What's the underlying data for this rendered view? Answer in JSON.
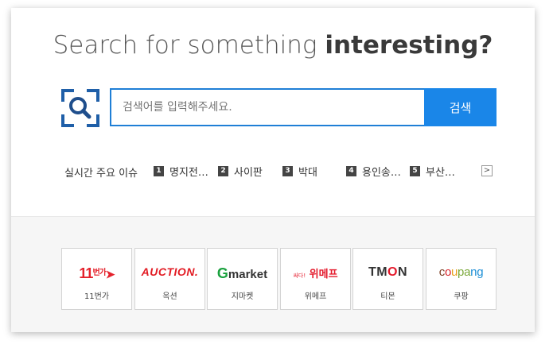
{
  "headline": {
    "prefix": "Search for something ",
    "emphasis": "interesting?"
  },
  "search": {
    "placeholder": "검색어를 입력해주세요.",
    "button_label": "검색"
  },
  "trending": {
    "label": "실시간 주요 이슈",
    "items": [
      {
        "rank": "1",
        "text": "명지전…"
      },
      {
        "rank": "2",
        "text": "사이판"
      },
      {
        "rank": "3",
        "text": "박대"
      },
      {
        "rank": "4",
        "text": "용인송…"
      },
      {
        "rank": "5",
        "text": "부산…"
      }
    ],
    "next_label": ">"
  },
  "shops": [
    {
      "logo_text": "11",
      "logo_sub": "번가",
      "name": "11번가",
      "color": "#e4222c"
    },
    {
      "logo_text": "AUCTION.",
      "name": "옥션",
      "color": "#e21b23"
    },
    {
      "logo_g": "G",
      "logo_text": "market",
      "name": "지마켓",
      "color": "#1aa13e"
    },
    {
      "logo_sub": "싸다!",
      "logo_text": "위메프",
      "name": "위메프",
      "color": "#e4192b"
    },
    {
      "logo_t": "TM",
      "logo_o": "O",
      "logo_n": "N",
      "name": "티몬",
      "color": "#333333"
    },
    {
      "logo_text": "coupang",
      "name": "쿠팡",
      "color": "#e4192b"
    }
  ],
  "colors": {
    "accent": "#1a86e8",
    "border_accent": "#1f7fd6"
  }
}
